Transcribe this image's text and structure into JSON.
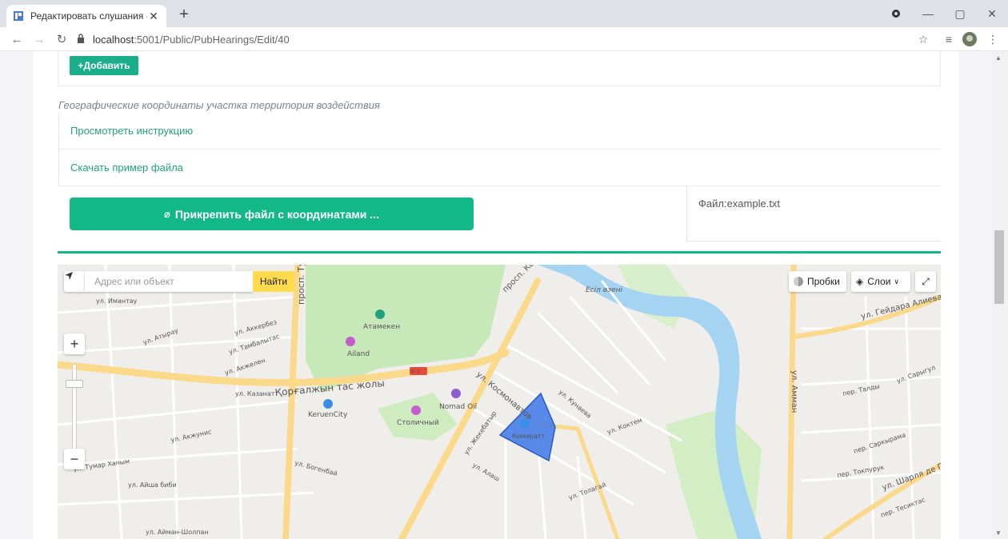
{
  "browser": {
    "tab_title": "Редактировать слушания - ЕЭП",
    "url_host": "localhost",
    "url_rest": ":5001/Public/PubHearings/Edit/40"
  },
  "page": {
    "add_button_label": "+Добавить",
    "section_title": "Географические координаты участка территория воздействия",
    "view_instruction": "Просмотреть инструкцию",
    "download_example": "Скачать пример файла",
    "attach_button_label": "Прикрепить файл с координатами ...",
    "file_label": "Файл:example.txt",
    "accent_color": "#12b886"
  },
  "map": {
    "search_placeholder": "Адрес или объект",
    "find_button": "Найти",
    "traffic_label": "Пробки",
    "layers_label": "Слои",
    "zoom_in": "+",
    "zoom_out": "−",
    "labels": {
      "turan": "просп. Туран",
      "kabanbay": "просп. Кабанбай",
      "korgalzhyn": "Қорғалжын тас жолы",
      "kosmonavtov": "ул. Космонавтов",
      "river": "Есіл өзені",
      "atameken": "Атамекен",
      "ailand": "Ailand",
      "keruen": "KeruenCity",
      "nomad": "Nomad Oil",
      "stolichny": "Столичный",
      "komirat": "Комиратт",
      "geidar": "ул. Гейдара Алиева",
      "amman": "ул. Амман",
      "sharl": "ул. Шарля де Голля",
      "imantau": "ул. Имантау",
      "akkerbez": "ул. Аккербез",
      "tamb": "ул. Тамбалытас",
      "akzhelen": "ул. Акжелен",
      "kazanat": "ул. Казанат",
      "atyrau": "ул. Атырау",
      "akzhunis": "ул. Акжунис",
      "tumar": "ул. Тумар Ханым",
      "aisha": "ул. Айша биби",
      "aiman": "ул. Айман-Шолпан",
      "bogenbay": "ул. Богенбай",
      "zhenbatyr": "ул. Жекебатыр",
      "aliasy": "ул. Алаш",
      "koktem": "ул. Коктем",
      "kunaeva": "ул. Кунаева",
      "tolagay": "ул. Толагай",
      "sarkyrama": "пер. Саркырама",
      "taldy": "пер. Талды",
      "sarygul": "ул. Сарыгул",
      "tokpuruk": "пер. Токпурук",
      "tesiktas": "пер. Тесиктас",
      "r2": "Р-2"
    }
  }
}
